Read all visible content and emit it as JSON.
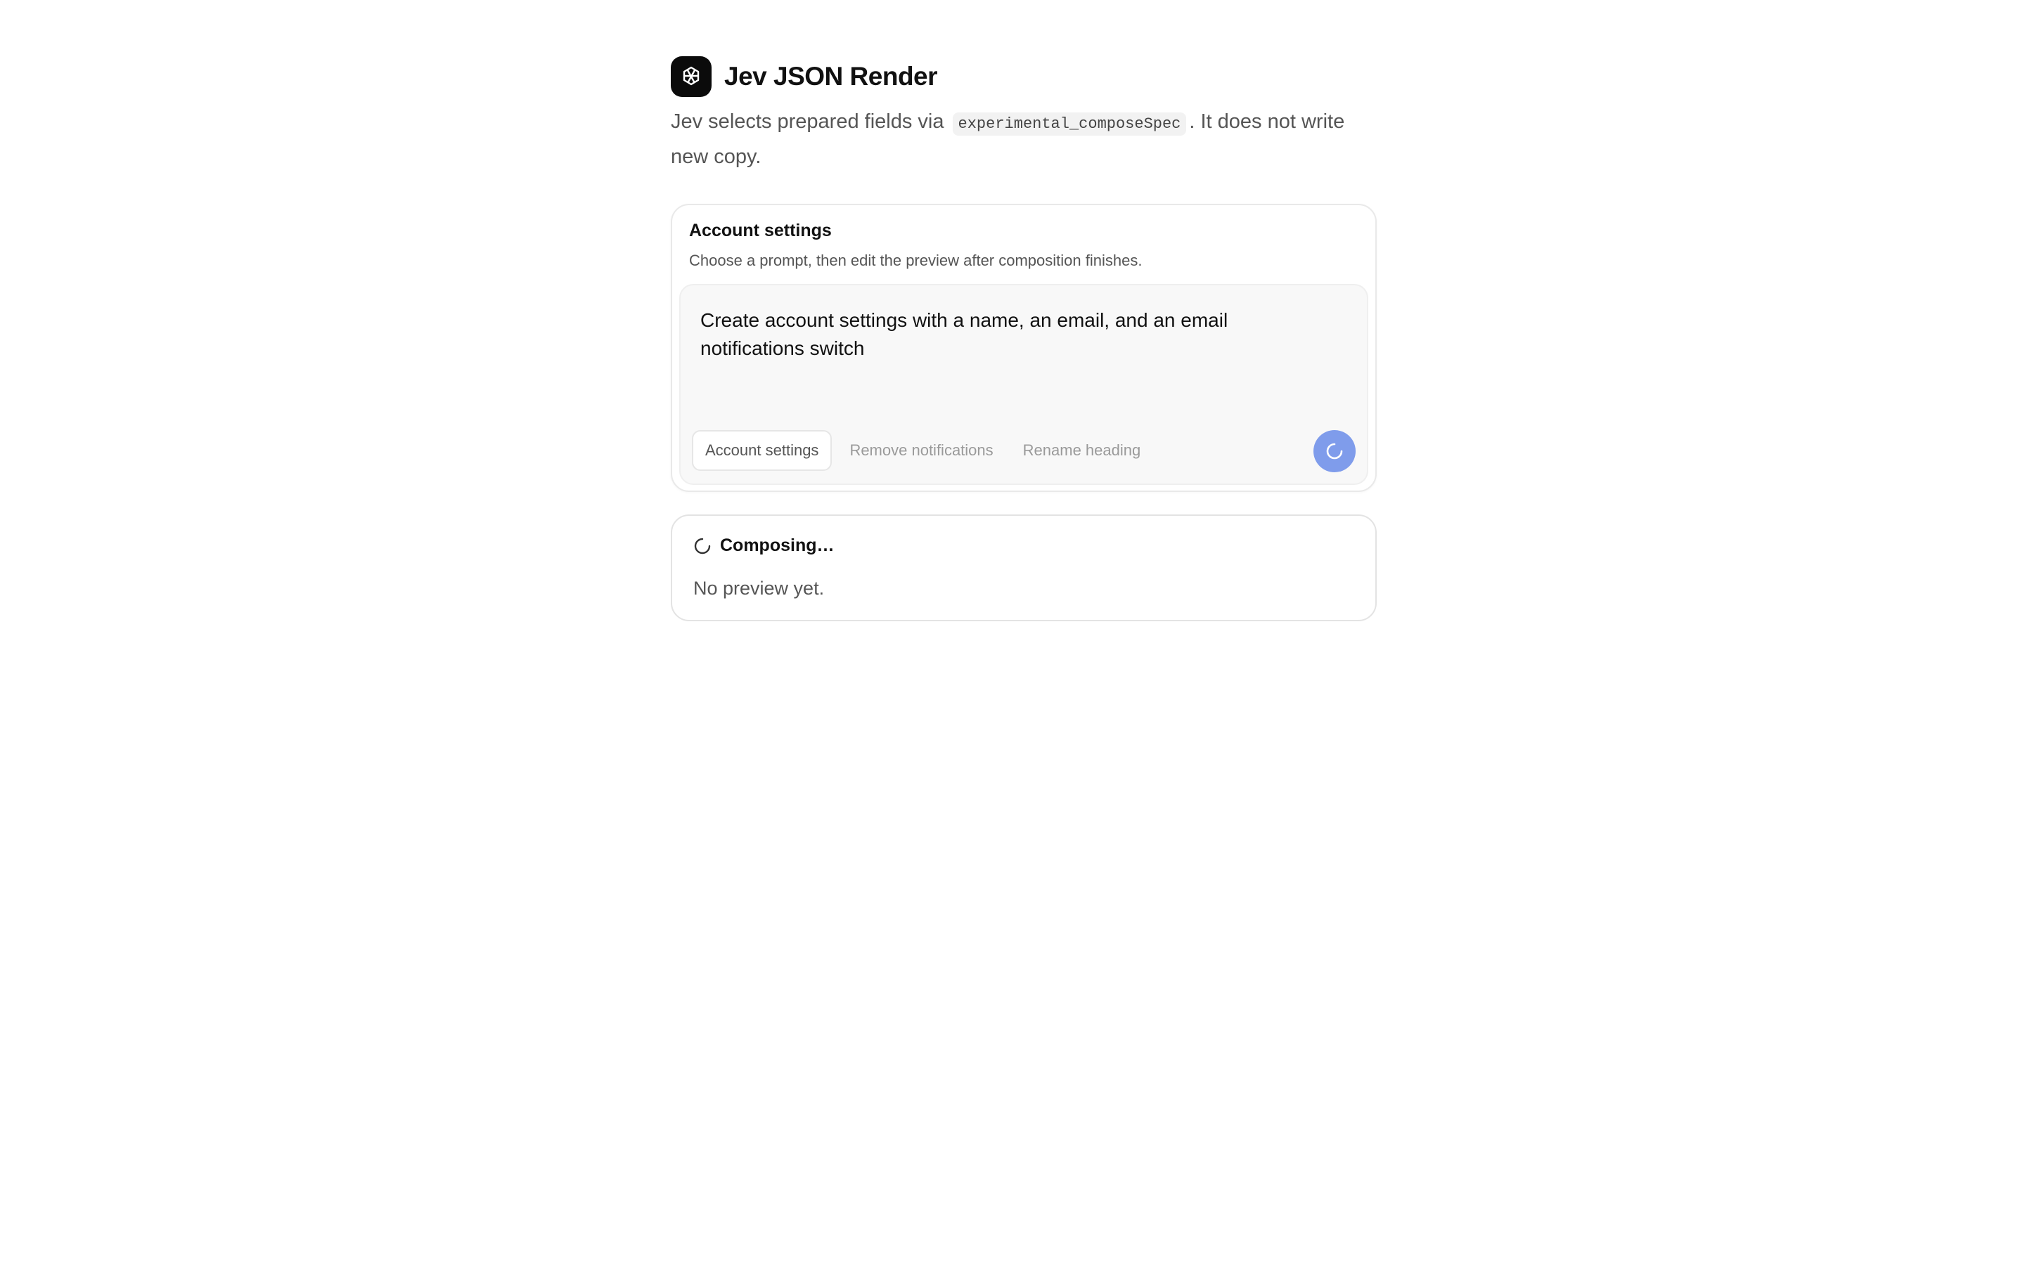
{
  "app": {
    "title": "Jev JSON Render",
    "logo_icon": "jev-logo-icon"
  },
  "description": {
    "before_code": "Jev selects prepared fields via ",
    "code": "experimental_composeSpec",
    "after_code": ". It does not write new copy."
  },
  "composer": {
    "title": "Account settings",
    "subtitle": "Choose a prompt, then edit the preview after composition finishes.",
    "prompt_value": "Create account settings with a name, an email, and an email notifications switch",
    "suggestions": [
      {
        "label": "Account settings",
        "selected": true
      },
      {
        "label": "Remove notifications",
        "selected": false
      },
      {
        "label": "Rename heading",
        "selected": false
      }
    ],
    "submit_icon": "loading-spinner-icon",
    "accent_color": "#7f9ceb"
  },
  "status": {
    "label": "Composing…",
    "icon": "loading-spinner-icon",
    "preview_text": "No preview yet."
  }
}
